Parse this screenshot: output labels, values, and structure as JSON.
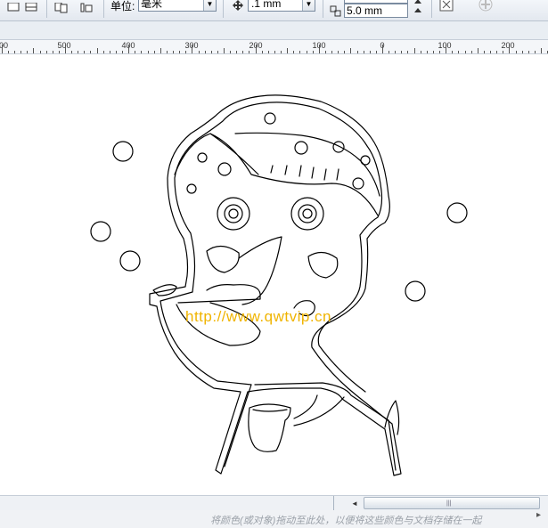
{
  "toolbar": {
    "unit_label": "单位:",
    "unit_value": "毫米",
    "nudge_value": ".1 mm",
    "duplicate_value": "5.0 mm"
  },
  "ruler": {
    "labels": [
      "00",
      "500",
      "400",
      "300",
      "200",
      "100",
      "0",
      "100",
      "200"
    ]
  },
  "canvas": {
    "watermark": "http://www.qwtvip.cn"
  },
  "status": {
    "hint": "将颜色(或对象)拖动至此处，以便将这些颜色与文档存储在一起"
  },
  "colors": {
    "watermark": "#f0b400",
    "outline": "#000000"
  }
}
